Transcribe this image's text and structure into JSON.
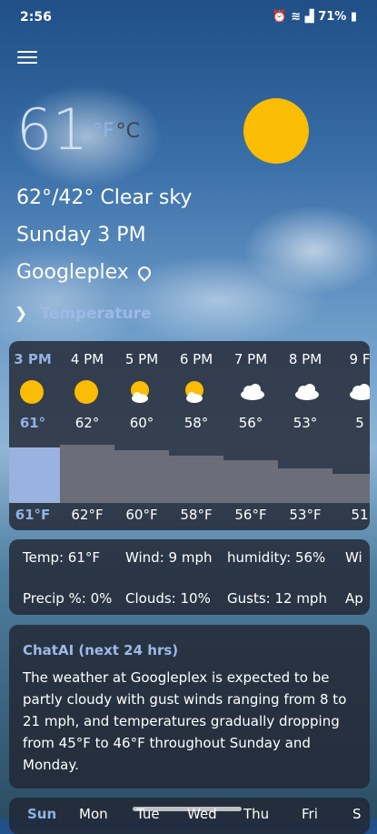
{
  "status": {
    "time": "2:56",
    "battery": "71%"
  },
  "main": {
    "temperature": "61",
    "unit_f": "°F",
    "unit_c": "°C",
    "summary": "62°/42°  Clear sky",
    "datetime": "Sunday 3 PM",
    "location": "Googleplex",
    "toggle_label": "Temperature"
  },
  "hourly": [
    {
      "time": "3 PM",
      "icon": "sun-icon",
      "temp": "61°",
      "temp_f": "61°F",
      "value": 61
    },
    {
      "time": "4 PM",
      "icon": "sun-icon",
      "temp": "62°",
      "temp_f": "62°F",
      "value": 62
    },
    {
      "time": "5 PM",
      "icon": "partly-cloudy-icon",
      "temp": "60°",
      "temp_f": "60°F",
      "value": 60
    },
    {
      "time": "6 PM",
      "icon": "partly-cloudy-icon",
      "temp": "58°",
      "temp_f": "58°F",
      "value": 58
    },
    {
      "time": "7 PM",
      "icon": "cloud-icon",
      "temp": "56°",
      "temp_f": "56°F",
      "value": 56
    },
    {
      "time": "8 PM",
      "icon": "cloud-icon",
      "temp": "53°",
      "temp_f": "53°F",
      "value": 53
    },
    {
      "time": "9 F",
      "icon": "cloud-icon",
      "temp": "5",
      "temp_f": "51",
      "value": 51
    }
  ],
  "details": {
    "temp": "Temp: 61°F",
    "wind": "Wind: 9 mph",
    "humidity": "humidity: 56%",
    "wi": "Wi",
    "precip": "Precip %: 0%",
    "clouds": "Clouds: 10%",
    "gusts": "Gusts: 12 mph",
    "ap": "Ap"
  },
  "chat": {
    "title": "ChatAI (next 24 hrs)",
    "body": "The weather at Googleplex is expected to be partly cloudy with gust winds ranging from 8 to 21 mph, and temperatures gradually dropping from 45°F to 46°F throughout Sunday and Monday."
  },
  "days": [
    "Sun",
    "Mon",
    "Tue",
    "Wed",
    "Thu",
    "Fri",
    "S"
  ],
  "colors": {
    "accent": "#8fb3e3",
    "sun": "#fbbc04",
    "card": "#222632",
    "bar": "#6b6e78"
  }
}
